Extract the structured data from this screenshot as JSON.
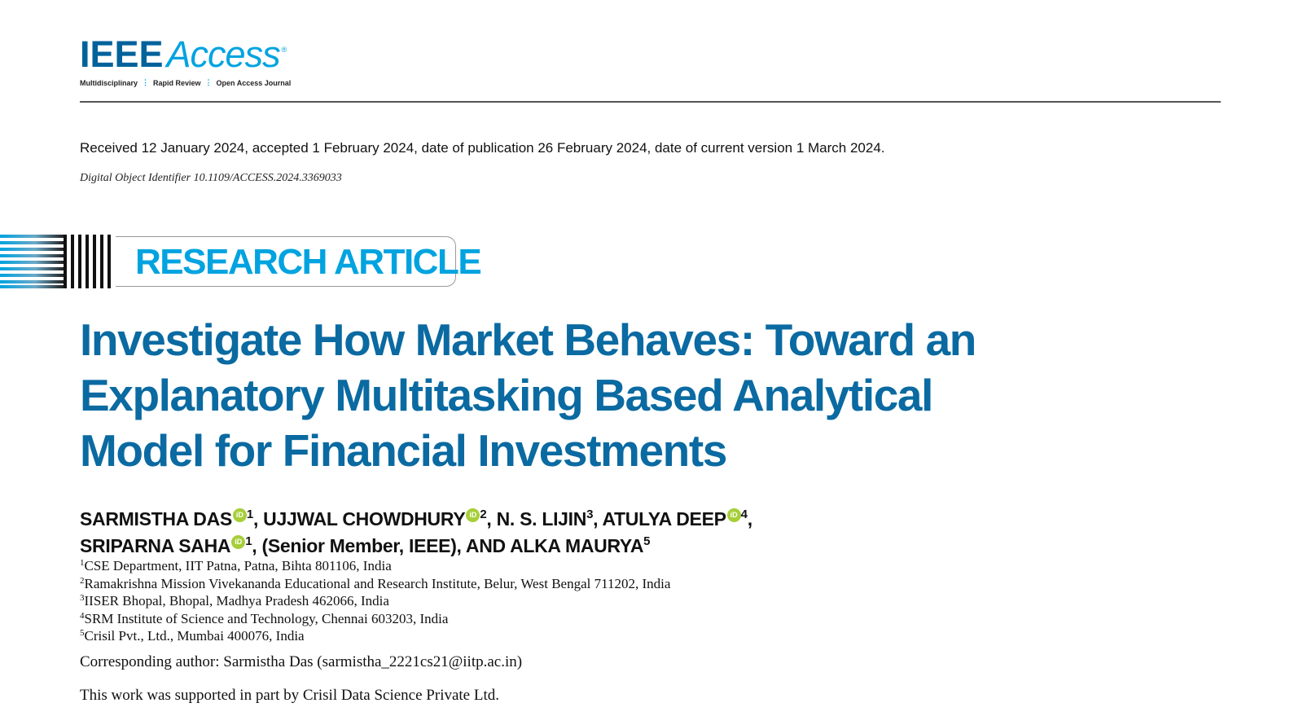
{
  "logo": {
    "ieee": "IEEE",
    "access": "Access",
    "registered": "®",
    "tagline": [
      "Multidisciplinary",
      "Rapid Review",
      "Open Access Journal"
    ],
    "tagline_separator": "⋮"
  },
  "received_line": "Received 12 January 2024, accepted 1 February 2024, date of publication 26 February 2024, date of current version 1 March 2024.",
  "doi": "Digital Object Identifier 10.1109/ACCESS.2024.3369033",
  "article_type": "RESEARCH ARTICLE",
  "title_lines": [
    "Investigate How Market Behaves: Toward an",
    "Explanatory Multitasking Based Analytical",
    "Model for Financial Investments"
  ],
  "authors": {
    "line1": [
      {
        "name": "SARMISTHA DAS",
        "orcid": true,
        "sup": "1",
        "suffix": ", "
      },
      {
        "name": "UJJWAL CHOWDHURY",
        "orcid": true,
        "sup": "2",
        "suffix": ", "
      },
      {
        "name": "N. S. LIJIN",
        "orcid": false,
        "sup": "3",
        "suffix": ", "
      },
      {
        "name": "ATULYA DEEP",
        "orcid": true,
        "sup": "4",
        "suffix": ","
      }
    ],
    "line2": [
      {
        "name": "SRIPARNA SAHA",
        "orcid": true,
        "sup": "1",
        "suffix": ", (Senior Member, IEEE), AND "
      },
      {
        "name": "ALKA MAURYA",
        "orcid": false,
        "sup": "5",
        "suffix": ""
      }
    ],
    "orcid_label": "iD"
  },
  "affiliations": [
    {
      "sup": "1",
      "text": "CSE Department, IIT Patna, Patna, Bihta 801106, India"
    },
    {
      "sup": "2",
      "text": "Ramakrishna Mission Vivekananda Educational and Research Institute, Belur, West Bengal 711202, India"
    },
    {
      "sup": "3",
      "text": "IISER Bhopal, Bhopal, Madhya Pradesh 462066, India"
    },
    {
      "sup": "4",
      "text": "SRM Institute of Science and Technology, Chennai 603203, India"
    },
    {
      "sup": "5",
      "text": "Crisil Pvt., Ltd., Mumbai 400076, India"
    }
  ],
  "corresponding_author": "Corresponding author: Sarmistha Das (sarmistha_2221cs21@iitp.ac.in)",
  "support": "This work was supported in part by Crisil Data Science Private Ltd.",
  "colors": {
    "ieee_blue": "#00629b",
    "access_cyan": "#00a3e0",
    "title_blue": "#0a6aa1",
    "orcid_green": "#a6ce39"
  }
}
